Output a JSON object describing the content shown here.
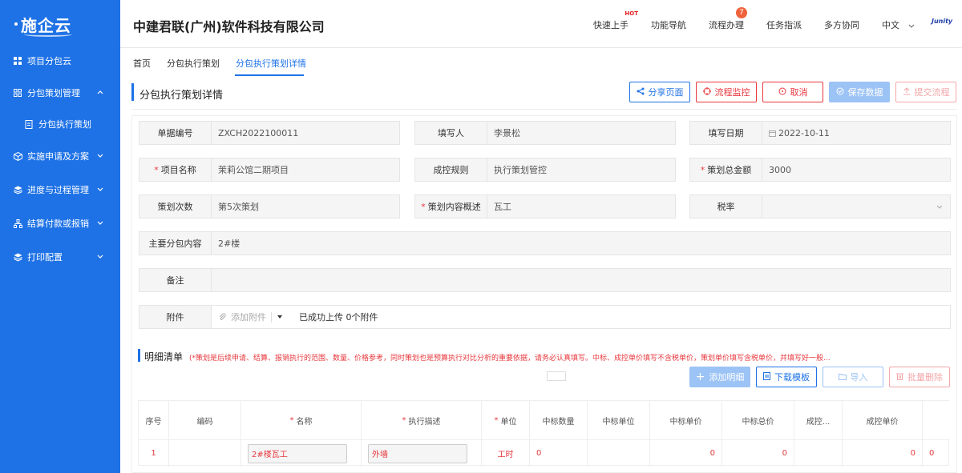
{
  "app": {
    "logo": "施企云"
  },
  "sidebar": {
    "items": [
      {
        "label": "项目分包云"
      },
      {
        "label": "分包策划管理"
      },
      {
        "label": "分包执行策划"
      },
      {
        "label": "实施申请及方案"
      },
      {
        "label": "进度与过程管理"
      },
      {
        "label": "结算付款或报销"
      },
      {
        "label": "打印配置"
      }
    ]
  },
  "header": {
    "company": "中建君联(广州)软件科技有限公司",
    "nav": [
      {
        "label": "快速上手",
        "badge": "HOT"
      },
      {
        "label": "功能导航"
      },
      {
        "label": "流程办理",
        "count": "7"
      },
      {
        "label": "任务指派"
      },
      {
        "label": "多方协同"
      }
    ],
    "language": "中文",
    "brand": "Junity"
  },
  "breadcrumb": {
    "items": [
      "首页",
      "分包执行策划",
      "分包执行策划详情"
    ]
  },
  "page": {
    "title": "分包执行策划详情",
    "buttons": {
      "share": "分享页面",
      "monitor": "流程监控",
      "cancel": "取消",
      "save": "保存数据",
      "submit": "提交流程"
    }
  },
  "form": {
    "doc_no": {
      "label": "单据编号",
      "value": "ZXCH2022100011"
    },
    "writer": {
      "label": "填写人",
      "value": "李景松"
    },
    "date": {
      "label": "填写日期",
      "value": "2022-10-11"
    },
    "project": {
      "label": "项目名称",
      "value": "茉莉公馆二期项目"
    },
    "cost_rule": {
      "label": "成控规则",
      "value": "执行策划管控"
    },
    "total_amount": {
      "label": "策划总金额",
      "value": "3000"
    },
    "times": {
      "label": "策划次数",
      "value": "第5次策划"
    },
    "summary": {
      "label": "策划内容概述",
      "value": "瓦工"
    },
    "tax": {
      "label": "税率",
      "value": ""
    },
    "main_content": {
      "label": "主要分包内容",
      "value": "2#楼"
    },
    "remark": {
      "label": "备注",
      "value": ""
    },
    "attachment": {
      "label": "附件",
      "add": "添加附件",
      "status": "已成功上传 0个附件"
    }
  },
  "detail": {
    "title": "明细清单",
    "note": "(*策划是后续申请、结算、报销执行的范围、数量、价格参考，同时策划也是预算执行对比分析的重要依据，请务必认真填写。中标、成控单价填写不含税单价，策划单价填写含税单价，并填写好一般...",
    "buttons": {
      "add": "添加明细",
      "download": "下载模板",
      "import": "导入",
      "batch_delete": "批量删除"
    },
    "columns": [
      "序号",
      "编码",
      "名称",
      "执行描述",
      "单位",
      "中标数量",
      "中标单位",
      "中标单价",
      "中标总价",
      "成控...",
      "成控单价"
    ],
    "rows": [
      {
        "index": "1",
        "code": "",
        "name": "2#楼瓦工",
        "desc": "外墙",
        "unit": "工时",
        "bid_qty": "0",
        "bid_unit": "",
        "bid_price": "0",
        "bid_total": "0",
        "ctrl": "",
        "ctrl_price": "0",
        "extra": "0"
      }
    ]
  },
  "colors": {
    "primary": "#1e72e6",
    "danger": "#e8383d"
  }
}
